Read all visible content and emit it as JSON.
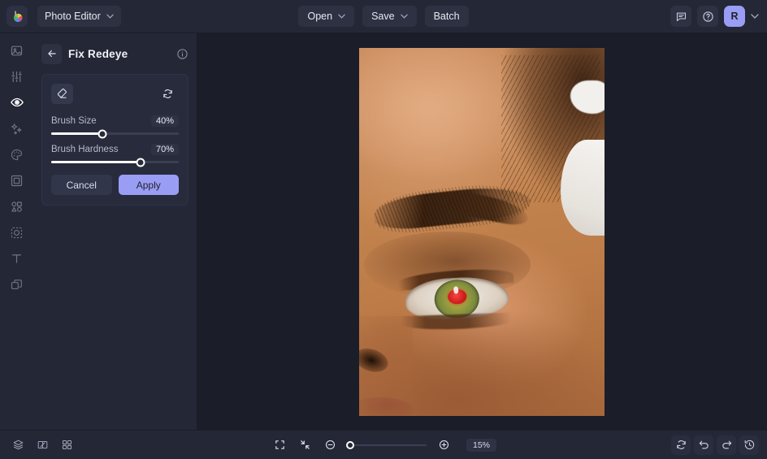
{
  "app": {
    "brand_label": "Photo Editor",
    "logo_icon": "app-logo-color-wheel"
  },
  "topbar": {
    "open_label": "Open",
    "save_label": "Save",
    "batch_label": "Batch",
    "open_caret": "⌄",
    "save_caret": "⌄",
    "brand_caret": "⌄",
    "account_caret": "⌄",
    "feedback_icon": "chat-bubble-icon",
    "help_icon": "question-circle-icon",
    "avatar_initial": "R"
  },
  "sidebar": {
    "items": [
      {
        "name": "sidebar-item-image",
        "icon": "image-icon",
        "active": false
      },
      {
        "name": "sidebar-item-adjust",
        "icon": "sliders-icon",
        "active": false
      },
      {
        "name": "sidebar-item-retouch",
        "icon": "eye-icon",
        "active": true
      },
      {
        "name": "sidebar-item-effects",
        "icon": "sparkles-icon",
        "active": false
      },
      {
        "name": "sidebar-item-color",
        "icon": "palette-icon",
        "active": false
      },
      {
        "name": "sidebar-item-frame",
        "icon": "frame-icon",
        "active": false
      },
      {
        "name": "sidebar-item-shapes",
        "icon": "shapes-icon",
        "active": false
      },
      {
        "name": "sidebar-item-cutout",
        "icon": "cutout-icon",
        "active": false
      },
      {
        "name": "sidebar-item-text",
        "icon": "text-t-icon",
        "active": false
      },
      {
        "name": "sidebar-item-layers",
        "icon": "layers-copy-icon",
        "active": false
      }
    ]
  },
  "panel": {
    "back_icon": "arrow-left-icon",
    "title": "Fix Redeye",
    "info_icon": "info-circle-icon",
    "tools": {
      "brush_icon": "eraser-icon",
      "reset_icon": "reset-refresh-icon"
    },
    "sliders": [
      {
        "label": "Brush Size",
        "value": "40%",
        "percent": 40
      },
      {
        "label": "Brush Hardness",
        "value": "70%",
        "percent": 70
      }
    ],
    "cancel_label": "Cancel",
    "apply_label": "Apply"
  },
  "canvas": {
    "image_description": "close-up portrait of a woman's eye with red pupil"
  },
  "bottombar": {
    "left_icons": [
      {
        "name": "layers-stack-icon"
      },
      {
        "name": "compare-split-icon"
      },
      {
        "name": "grid-view-icon"
      }
    ],
    "fit_icon": "fit-to-screen-icon",
    "actual_size_icon": "collapse-arrows-icon",
    "zoom_out_icon": "zoom-out-icon",
    "zoom_in_icon": "zoom-in-icon",
    "zoom_value": "15%",
    "zoom_percent": 15,
    "right_icons": [
      {
        "name": "reset-view-icon"
      },
      {
        "name": "undo-icon"
      },
      {
        "name": "redo-icon"
      },
      {
        "name": "history-icon"
      }
    ]
  },
  "colors": {
    "panel_bg": "#242736",
    "canvas_bg": "#1b1d29",
    "accent": "#9a9df4",
    "redeye": "#d41f1f"
  }
}
